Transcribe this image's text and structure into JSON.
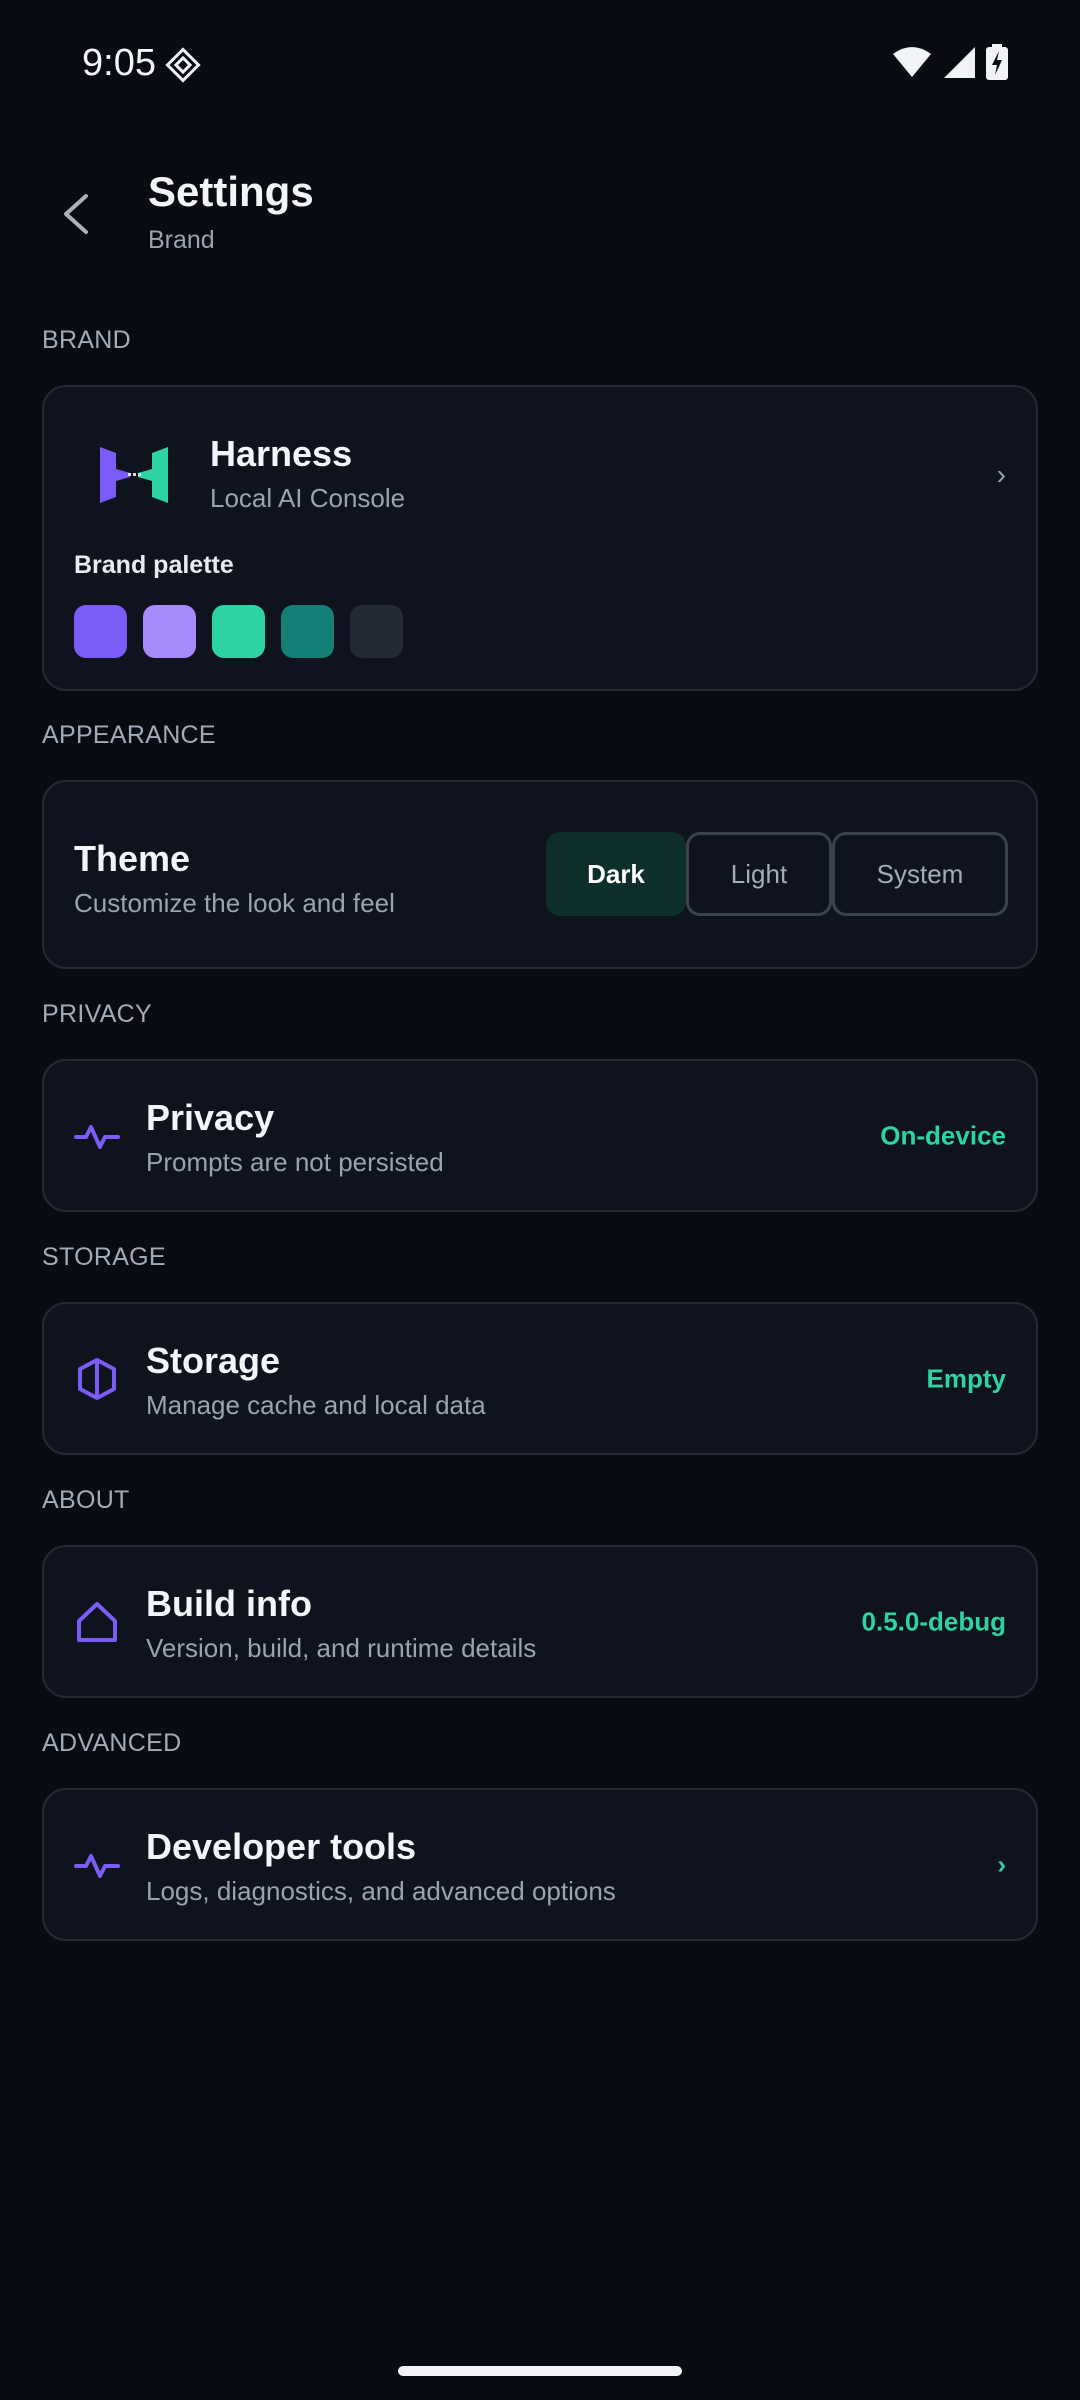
{
  "status": {
    "time": "9:05"
  },
  "header": {
    "title": "Settings",
    "subtitle": "Brand"
  },
  "sections": {
    "brand": "BRAND",
    "appearance": "APPEARANCE",
    "privacy": "PRIVACY",
    "storage": "STORAGE",
    "about": "ABOUT",
    "advanced": "ADVANCED"
  },
  "brand": {
    "name": "Harness",
    "tagline": "Local AI Console",
    "chevron": "›",
    "palette_label": "Brand palette",
    "palette": [
      "#7c5cf6",
      "#a88bfa",
      "#2ed3a4",
      "#147f77",
      "#232a36"
    ]
  },
  "theme": {
    "title": "Theme",
    "subtitle": "Customize the look and feel",
    "options": [
      "Dark",
      "Light",
      "System"
    ],
    "selected": "Dark"
  },
  "privacy": {
    "title": "Privacy",
    "subtitle": "Prompts are not persisted",
    "value": "On-device",
    "icon": "activity-icon"
  },
  "storage": {
    "title": "Storage",
    "subtitle": "Manage cache and local data",
    "value": "Empty",
    "icon": "hexagon-icon"
  },
  "about": {
    "title": "Build info",
    "subtitle": "Version, build, and runtime details",
    "value": "0.5.0-debug",
    "icon": "home-icon"
  },
  "advanced": {
    "title": "Developer tools",
    "subtitle": "Logs, diagnostics, and advanced options",
    "value": "›",
    "icon": "activity-icon"
  },
  "colors": {
    "accent": "#2ed3a4",
    "brand_purple": "#7c5cf6",
    "background": "#080b12",
    "card": "#0e131d"
  }
}
